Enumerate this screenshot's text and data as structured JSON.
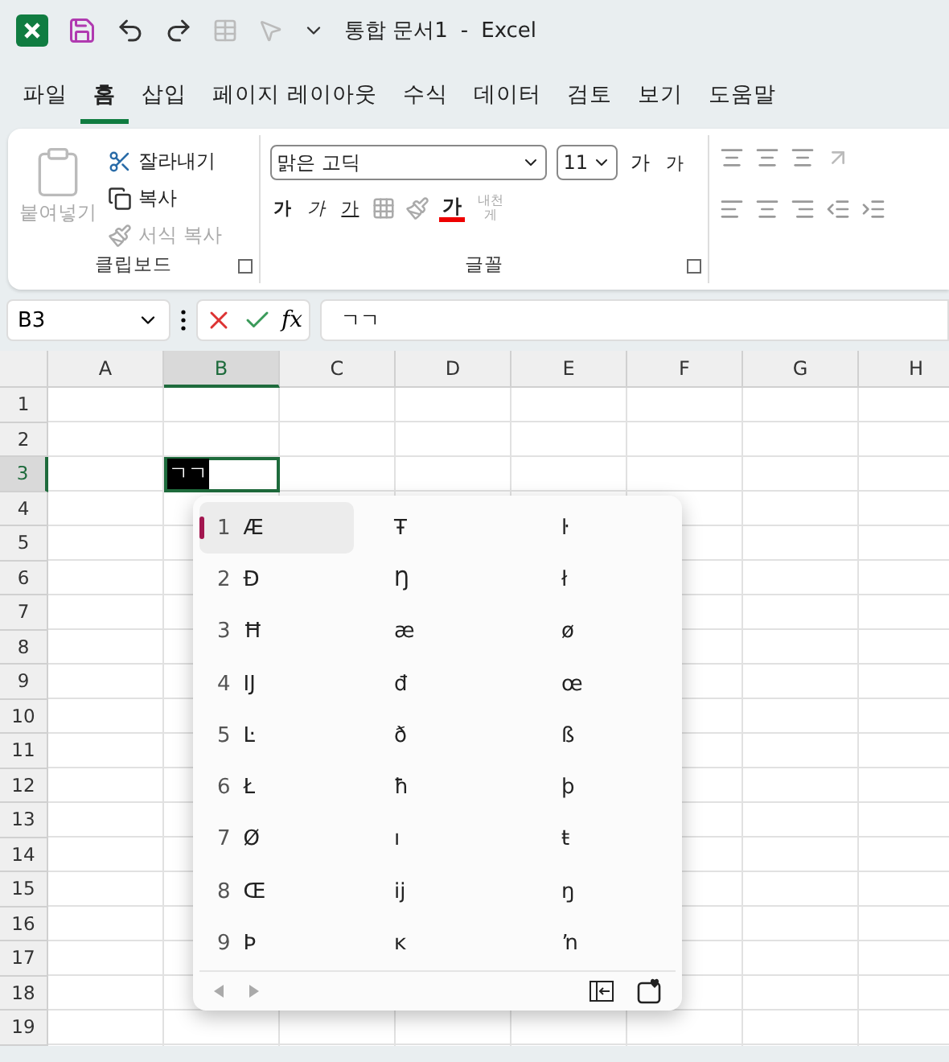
{
  "title_bar": {
    "document": "통합 문서1",
    "separator": "-",
    "app": "Excel"
  },
  "menu_tabs": [
    {
      "label": "파일",
      "selected": false
    },
    {
      "label": "홈",
      "selected": true
    },
    {
      "label": "삽입",
      "selected": false
    },
    {
      "label": "페이지 레이아웃",
      "selected": false
    },
    {
      "label": "수식",
      "selected": false
    },
    {
      "label": "데이터",
      "selected": false
    },
    {
      "label": "검토",
      "selected": false
    },
    {
      "label": "보기",
      "selected": false
    },
    {
      "label": "도움말",
      "selected": false
    }
  ],
  "ribbon": {
    "clipboard": {
      "paste": "붙여넣기",
      "cut": "잘라내기",
      "copy": "복사",
      "format_painter": "서식 복사",
      "label": "클립보드"
    },
    "font": {
      "font_name": "맑은 고딕",
      "font_size": "11",
      "grow": "가",
      "shrink": "가",
      "bold": "가",
      "italic": "가",
      "underline": "가",
      "font_color": "가",
      "wrap": "내천게",
      "label": "글꼴"
    }
  },
  "formula_bar": {
    "name_box": "B3",
    "function_label": "fx",
    "formula": "ㄱㄱ"
  },
  "sheet": {
    "columns": [
      {
        "label": "A",
        "selected": false
      },
      {
        "label": "B",
        "selected": true
      },
      {
        "label": "C",
        "selected": false
      },
      {
        "label": "D",
        "selected": false
      },
      {
        "label": "E",
        "selected": false
      },
      {
        "label": "F",
        "selected": false
      },
      {
        "label": "G",
        "selected": false
      },
      {
        "label": "H",
        "selected": false
      }
    ],
    "rows": [
      {
        "label": "1",
        "selected": false
      },
      {
        "label": "2",
        "selected": false
      },
      {
        "label": "3",
        "selected": true
      },
      {
        "label": "4",
        "selected": false
      },
      {
        "label": "5",
        "selected": false
      },
      {
        "label": "6",
        "selected": false
      },
      {
        "label": "7",
        "selected": false
      },
      {
        "label": "8",
        "selected": false
      },
      {
        "label": "9",
        "selected": false
      },
      {
        "label": "10",
        "selected": false
      },
      {
        "label": "11",
        "selected": false
      },
      {
        "label": "12",
        "selected": false
      },
      {
        "label": "13",
        "selected": false
      },
      {
        "label": "14",
        "selected": false
      },
      {
        "label": "15",
        "selected": false
      },
      {
        "label": "16",
        "selected": false
      },
      {
        "label": "17",
        "selected": false
      },
      {
        "label": "18",
        "selected": false
      },
      {
        "label": "19",
        "selected": false
      }
    ],
    "active_cell": {
      "value": "ㄱㄱ"
    }
  },
  "candidate_window": {
    "candidates": [
      {
        "number": "1",
        "char": "Æ",
        "selected": true
      },
      {
        "number": "2",
        "char": "Đ",
        "selected": false
      },
      {
        "number": "3",
        "char": "Ħ",
        "selected": false
      },
      {
        "number": "4",
        "char": "Ĳ",
        "selected": false
      },
      {
        "number": "5",
        "char": "Ŀ",
        "selected": false
      },
      {
        "number": "6",
        "char": "Ł",
        "selected": false
      },
      {
        "number": "7",
        "char": "Ø",
        "selected": false
      },
      {
        "number": "8",
        "char": "Œ",
        "selected": false
      },
      {
        "number": "9",
        "char": "Þ",
        "selected": false
      }
    ],
    "column_2": [
      "Ŧ",
      "Ŋ",
      "æ",
      "đ",
      "ð",
      "ħ",
      "ı",
      "ĳ",
      "ĸ"
    ],
    "column_3": [
      "ŀ",
      "ł",
      "ø",
      "œ",
      "ß",
      "þ",
      "ŧ",
      "ŋ",
      "ŉ"
    ]
  }
}
